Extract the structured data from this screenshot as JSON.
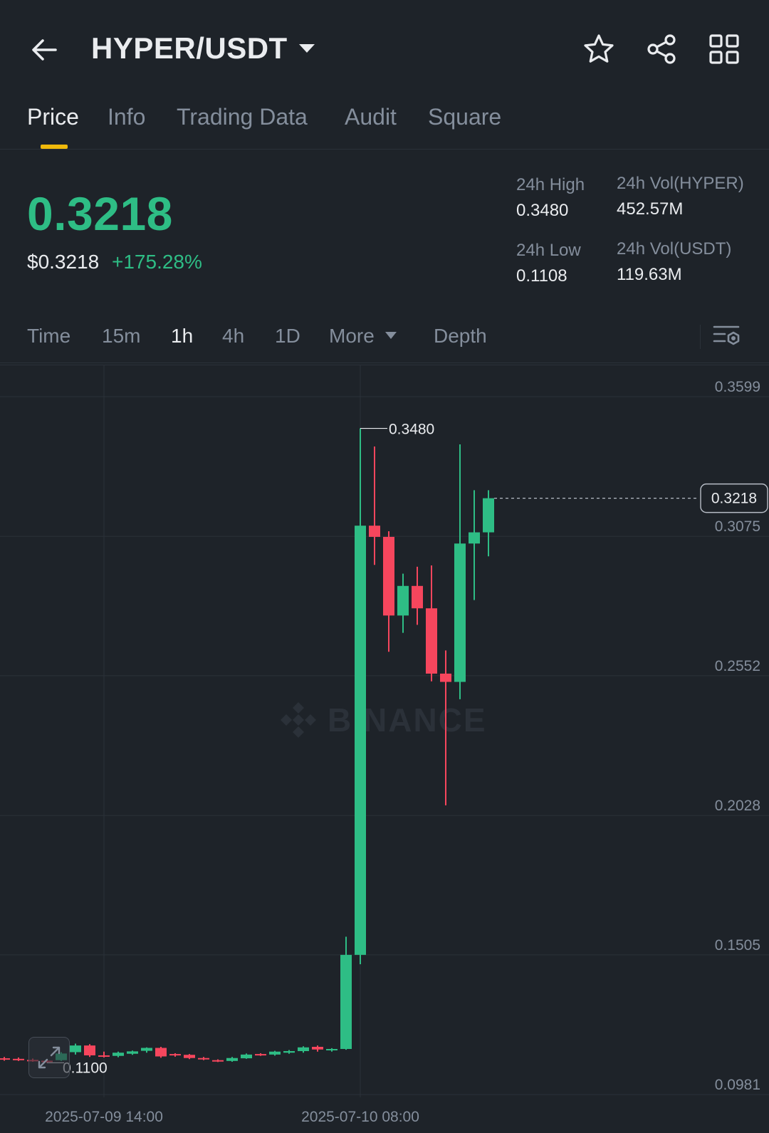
{
  "header": {
    "pair": "HYPER/USDT",
    "icons": [
      "back-arrow-icon",
      "caret-down-icon",
      "star-icon",
      "share-icon",
      "grid-apps-icon"
    ]
  },
  "tabs": [
    {
      "label": "Price",
      "active": true
    },
    {
      "label": "Info",
      "active": false
    },
    {
      "label": "Trading Data",
      "active": false
    },
    {
      "label": "Audit",
      "active": false
    },
    {
      "label": "Square",
      "active": false
    }
  ],
  "ticker": {
    "last_price": "0.3218",
    "usd_price": "$0.3218",
    "change_pct": "+175.28%",
    "high_label": "24h High",
    "high_value": "0.3480",
    "low_label": "24h Low",
    "low_value": "0.1108",
    "vol_base_label": "24h Vol(HYPER)",
    "vol_base_value": "452.57M",
    "vol_quote_label": "24h Vol(USDT)",
    "vol_quote_value": "119.63M"
  },
  "intervals": [
    {
      "label": "Time",
      "active": false
    },
    {
      "label": "15m",
      "active": false
    },
    {
      "label": "1h",
      "active": true
    },
    {
      "label": "4h",
      "active": false
    },
    {
      "label": "1D",
      "active": false
    },
    {
      "label": "More",
      "active": false
    },
    {
      "label": "Depth",
      "active": false
    }
  ],
  "watermark": "BINANCE",
  "colors": {
    "background": "#1e2329",
    "up": "#2ebd85",
    "down": "#f6465d",
    "accent": "#f0b90b",
    "muted": "#848e9c",
    "text": "#eaecef"
  },
  "chart_data": {
    "type": "candlestick",
    "y_ticks": [
      "0.3599",
      "0.3075",
      "0.2552",
      "0.2028",
      "0.1505",
      "0.0981"
    ],
    "y_tick_values": [
      0.3599,
      0.3075,
      0.2552,
      0.2028,
      0.1505,
      0.0981
    ],
    "ylim": [
      0.0981,
      0.3599
    ],
    "x_ticks": [
      {
        "label": "2025-07-09 14:00",
        "index": 7
      },
      {
        "label": "2025-07-10 08:00",
        "index": 25
      }
    ],
    "max_label": "0.3480",
    "min_label": "0.1100",
    "last_price_label": "0.3218",
    "last_price": 0.3218,
    "candles": [
      {
        "o": 0.1117,
        "h": 0.1122,
        "l": 0.1108,
        "c": 0.1113
      },
      {
        "o": 0.1115,
        "h": 0.112,
        "l": 0.1107,
        "c": 0.111
      },
      {
        "o": 0.1111,
        "h": 0.1116,
        "l": 0.1104,
        "c": 0.1108
      },
      {
        "o": 0.1108,
        "h": 0.1113,
        "l": 0.11,
        "c": 0.1107
      },
      {
        "o": 0.111,
        "h": 0.114,
        "l": 0.1107,
        "c": 0.1135
      },
      {
        "o": 0.114,
        "h": 0.1172,
        "l": 0.1131,
        "c": 0.1165
      },
      {
        "o": 0.1165,
        "h": 0.117,
        "l": 0.1122,
        "c": 0.1128
      },
      {
        "o": 0.1128,
        "h": 0.1142,
        "l": 0.112,
        "c": 0.1126
      },
      {
        "o": 0.1126,
        "h": 0.1142,
        "l": 0.1121,
        "c": 0.1138
      },
      {
        "o": 0.1134,
        "h": 0.1146,
        "l": 0.113,
        "c": 0.1143
      },
      {
        "o": 0.1145,
        "h": 0.1158,
        "l": 0.1138,
        "c": 0.1156
      },
      {
        "o": 0.1156,
        "h": 0.116,
        "l": 0.1119,
        "c": 0.1124
      },
      {
        "o": 0.1133,
        "h": 0.1136,
        "l": 0.1123,
        "c": 0.1128
      },
      {
        "o": 0.113,
        "h": 0.1133,
        "l": 0.1114,
        "c": 0.1118
      },
      {
        "o": 0.1118,
        "h": 0.1122,
        "l": 0.111,
        "c": 0.1113
      },
      {
        "o": 0.111,
        "h": 0.1113,
        "l": 0.1103,
        "c": 0.1106
      },
      {
        "o": 0.1107,
        "h": 0.1122,
        "l": 0.1104,
        "c": 0.1118
      },
      {
        "o": 0.1117,
        "h": 0.1135,
        "l": 0.1115,
        "c": 0.1131
      },
      {
        "o": 0.1133,
        "h": 0.1136,
        "l": 0.1126,
        "c": 0.113
      },
      {
        "o": 0.1131,
        "h": 0.1145,
        "l": 0.1127,
        "c": 0.1142
      },
      {
        "o": 0.1138,
        "h": 0.1148,
        "l": 0.1134,
        "c": 0.1144
      },
      {
        "o": 0.1144,
        "h": 0.1162,
        "l": 0.1138,
        "c": 0.1158
      },
      {
        "o": 0.116,
        "h": 0.1165,
        "l": 0.1142,
        "c": 0.115
      },
      {
        "o": 0.1148,
        "h": 0.1155,
        "l": 0.1142,
        "c": 0.1152
      },
      {
        "o": 0.1152,
        "h": 0.1573,
        "l": 0.1149,
        "c": 0.1505
      },
      {
        "o": 0.1505,
        "h": 0.348,
        "l": 0.147,
        "c": 0.3115
      },
      {
        "o": 0.3115,
        "h": 0.3412,
        "l": 0.2968,
        "c": 0.3073
      },
      {
        "o": 0.3073,
        "h": 0.3094,
        "l": 0.2642,
        "c": 0.2778
      },
      {
        "o": 0.2778,
        "h": 0.2935,
        "l": 0.2713,
        "c": 0.2889
      },
      {
        "o": 0.2889,
        "h": 0.2961,
        "l": 0.2743,
        "c": 0.2805
      },
      {
        "o": 0.2805,
        "h": 0.2966,
        "l": 0.2531,
        "c": 0.256
      },
      {
        "o": 0.256,
        "h": 0.2647,
        "l": 0.2066,
        "c": 0.2529
      },
      {
        "o": 0.2529,
        "h": 0.342,
        "l": 0.2464,
        "c": 0.3048
      },
      {
        "o": 0.3048,
        "h": 0.3248,
        "l": 0.2836,
        "c": 0.309
      },
      {
        "o": 0.309,
        "h": 0.3248,
        "l": 0.3,
        "c": 0.3218
      }
    ]
  }
}
